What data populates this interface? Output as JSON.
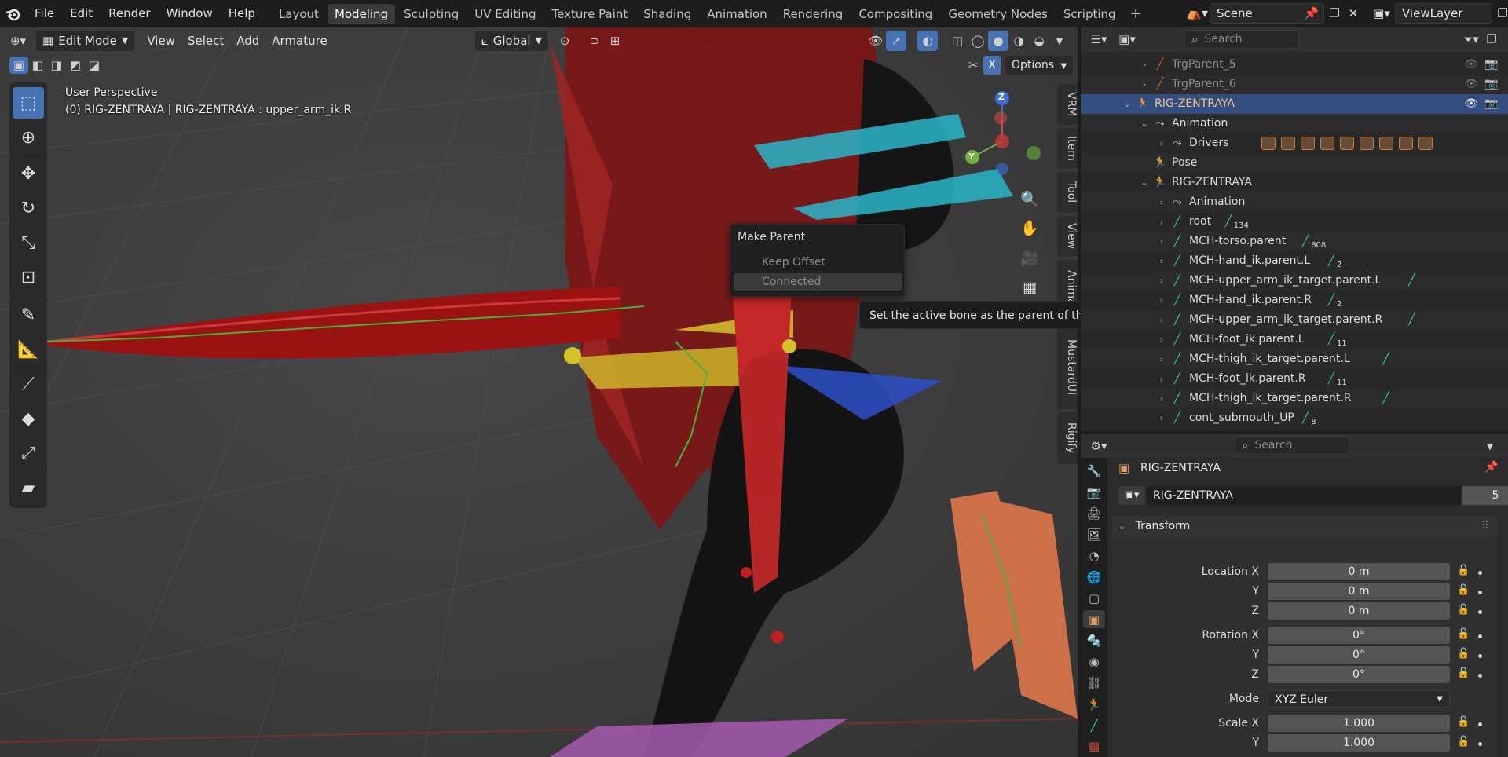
{
  "app": {
    "logo": "blender-logo-icon"
  },
  "menu": [
    "File",
    "Edit",
    "Render",
    "Window",
    "Help"
  ],
  "workspaces": [
    "Layout",
    "Modeling",
    "Sculpting",
    "UV Editing",
    "Texture Paint",
    "Shading",
    "Animation",
    "Rendering",
    "Compositing",
    "Geometry Nodes",
    "Scripting"
  ],
  "active_workspace": "Modeling",
  "scene": {
    "label": "Scene",
    "view_layer": "ViewLayer"
  },
  "viewport": {
    "mode": "Edit Mode",
    "menus": [
      "View",
      "Select",
      "Add",
      "Armature"
    ],
    "orientation": "Global",
    "options_label": "Options",
    "x_label": "X",
    "info_line1": "User Perspective",
    "info_line2": "(0) RIG-ZENTRAYA | RIG-ZENTRAYA : upper_arm_ik.R",
    "side_tabs": [
      "VRM",
      "Item",
      "Tool",
      "View",
      "Animati",
      "MustardUI",
      "Rigify"
    ],
    "gizmo": {
      "z": "Z",
      "y": "Y"
    }
  },
  "popup": {
    "title": "Make Parent",
    "items": [
      "Keep Offset",
      "Connected"
    ],
    "tooltip": "Set the active bone as the parent of the selected bones."
  },
  "outliner": {
    "search_placeholder": "Search",
    "rows": [
      {
        "label": "TrgParent_5",
        "indent": 3,
        "icon": "bone-icon",
        "dim": true
      },
      {
        "label": "TrgParent_6",
        "indent": 3,
        "icon": "bone-icon",
        "dim": true
      },
      {
        "label": "RIG-ZENTRAYA",
        "indent": 2,
        "icon": "armature-icon",
        "selected": true
      },
      {
        "label": "Animation",
        "indent": 3,
        "icon": "animation-icon"
      },
      {
        "label": "Drivers",
        "indent": 4,
        "icon": "drivers-icon"
      },
      {
        "label": "Pose",
        "indent": 3,
        "icon": "pose-icon"
      },
      {
        "label": "RIG-ZENTRAYA",
        "indent": 3,
        "icon": "armature-data-icon"
      },
      {
        "label": "Animation",
        "indent": 4,
        "icon": "animation-icon"
      },
      {
        "label": "root",
        "indent": 4,
        "icon": "bone-icon",
        "sub": "134"
      },
      {
        "label": "MCH-torso.parent",
        "indent": 4,
        "icon": "bone-icon",
        "sub": "808"
      },
      {
        "label": "MCH-hand_ik.parent.L",
        "indent": 4,
        "icon": "bone-icon",
        "sub": "2"
      },
      {
        "label": "MCH-upper_arm_ik_target.parent.L",
        "indent": 4,
        "icon": "bone-icon"
      },
      {
        "label": "MCH-hand_ik.parent.R",
        "indent": 4,
        "icon": "bone-icon",
        "sub": "2"
      },
      {
        "label": "MCH-upper_arm_ik_target.parent.R",
        "indent": 4,
        "icon": "bone-icon"
      },
      {
        "label": "MCH-foot_ik.parent.L",
        "indent": 4,
        "icon": "bone-icon",
        "sub": "11"
      },
      {
        "label": "MCH-thigh_ik_target.parent.L",
        "indent": 4,
        "icon": "bone-icon"
      },
      {
        "label": "MCH-foot_ik.parent.R",
        "indent": 4,
        "icon": "bone-icon",
        "sub": "11"
      },
      {
        "label": "MCH-thigh_ik_target.parent.R",
        "indent": 4,
        "icon": "bone-icon"
      },
      {
        "label": "cont_submouth_UP",
        "indent": 4,
        "icon": "bone-icon",
        "sub": "8"
      }
    ]
  },
  "properties": {
    "search_placeholder": "Search",
    "object_name": "RIG-ZENTRAYA",
    "data_name": "RIG-ZENTRAYA",
    "users": "5",
    "panel_title": "Transform",
    "location": {
      "label": "Location X",
      "x": "0 m",
      "y": "0 m",
      "z": "0 m"
    },
    "rotation": {
      "label": "Rotation X",
      "x": "0°",
      "y": "0°",
      "z": "0°"
    },
    "mode": {
      "label": "Mode",
      "value": "XYZ Euler"
    },
    "scale": {
      "label": "Scale X",
      "x": "1.000",
      "y": "1.000"
    },
    "axis_y": "Y",
    "axis_z": "Z"
  },
  "colors": {
    "accent": "#4772b3",
    "selected_row": "#334d80",
    "bone": "#31c9a7",
    "object_orange": "#e29a5c"
  }
}
